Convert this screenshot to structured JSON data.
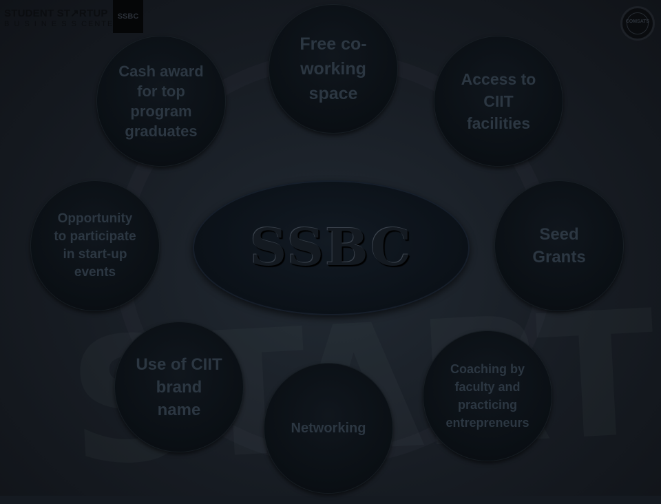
{
  "logo": {
    "line1": "STUDENT ST↗RTUP",
    "line2": "B U S I N E S S   CENTER",
    "box_text": "SSBC"
  },
  "badge": {
    "text": "COMSATS"
  },
  "watermark": "STARTUP",
  "center": {
    "label": "SSBC"
  },
  "nodes": {
    "coworking": "Free  co-working space",
    "ciit_facilities": "Access to CIIT facilities",
    "cash_award": "Cash award for top program graduates",
    "events": "Opportunity to participate in start-up events",
    "seed_grants": "Seed Grants",
    "brand_name": "Use of CIIT brand name",
    "networking": "Networking",
    "coaching": "Coaching by faculty and practicing entrepreneurs"
  }
}
